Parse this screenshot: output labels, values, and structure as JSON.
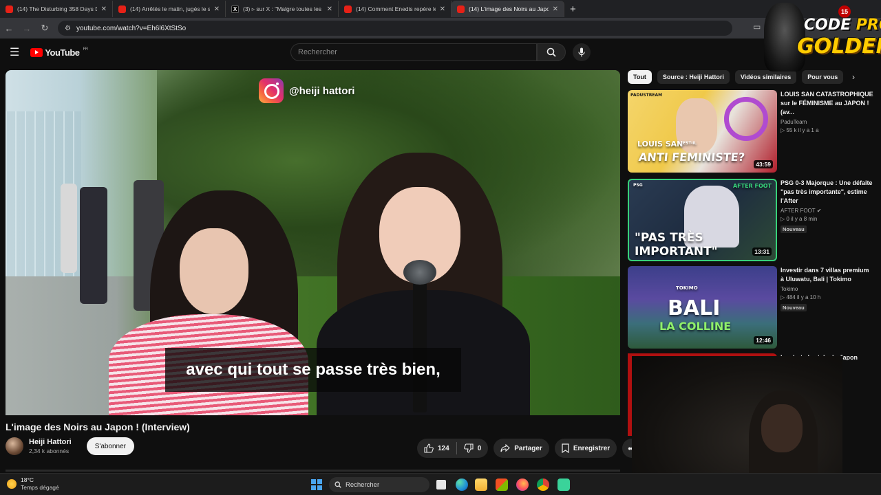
{
  "browser": {
    "tabs": [
      {
        "title": "(14) The Disturbing 358 Days D",
        "icon": "youtube-icon"
      },
      {
        "title": "(14) Arrêtés le matin, jugés le s",
        "icon": "youtube-icon"
      },
      {
        "title": "(3) ▹ sur X : \"Malgre toutes les",
        "icon": "x-icon"
      },
      {
        "title": "(14) Comment Enedis repère le",
        "icon": "youtube-icon"
      },
      {
        "title": "(14) L'image des Noirs au Japon",
        "icon": "youtube-icon"
      }
    ],
    "url": "youtube.com/watch?v=Eh6l6XtStSo"
  },
  "youtube": {
    "logo_text": "YouTube",
    "region": "FR",
    "search_placeholder": "Rechercher"
  },
  "video": {
    "overlay_handle": "@heiji hattori",
    "subtitle": "avec qui tout se passe très bien,",
    "title": "L'image des Noirs au Japon ! (Interview)",
    "channel_name": "Heiji Hattori",
    "subscribers": "2,34 k abonnés",
    "subscribe_label": "S'abonner",
    "likes": "124",
    "dislikes": "0",
    "share_label": "Partager",
    "save_label": "Enregistrer"
  },
  "chips": [
    "Tout",
    "Source : Heiji Hattori",
    "Vidéos similaires",
    "Pour vous"
  ],
  "recommendations": [
    {
      "title": "LOUIS SAN CATASTROPHIQUE sur le FÉMINISME au JAPON ! (av...",
      "channel": "PaduTeam",
      "meta": "▷ 55 k   il y a 1 a",
      "duration": "43:59",
      "thumb_text_1": "LOUIS SAN",
      "thumb_text_2": "ANTI FEMINISTE?",
      "thumb_tag": "PADUSTREAM",
      "thumb_small": "EST-IL"
    },
    {
      "title": "PSG 0-3 Majorque : Une défaite \"pas très importante\", estime l'After",
      "channel": "AFTER FOOT",
      "meta": "▷ 0   il y a 8 min",
      "badge": "Nouveau",
      "duration": "13:31",
      "thumb_text_1": "\"PAS TRÈS",
      "thumb_text_2": "IMPORTANT\"",
      "thumb_tag": "AFTER FOOT",
      "thumb_small": "PSG"
    },
    {
      "title": "Investir dans 7 villas premium à Uluwatu, Bali | Tokimo",
      "channel": "Tokimo",
      "meta": "▷ 484   il y a 10 h",
      "badge": "Nouveau",
      "duration": "12:46",
      "thumb_text_1": "BALI",
      "thumb_text_2": "LA COLLINE",
      "thumb_tag": "TOKIMO"
    },
    {
      "title": "La chute brutale du Japon"
    }
  ],
  "promo": {
    "line1_a": "CODE ",
    "line1_b": "PROZIS",
    "line2": "GOLDENG",
    "badge": "15"
  },
  "taskbar": {
    "temperature": "18°C",
    "weather": "Temps dégagé",
    "search_label": "Rechercher"
  }
}
